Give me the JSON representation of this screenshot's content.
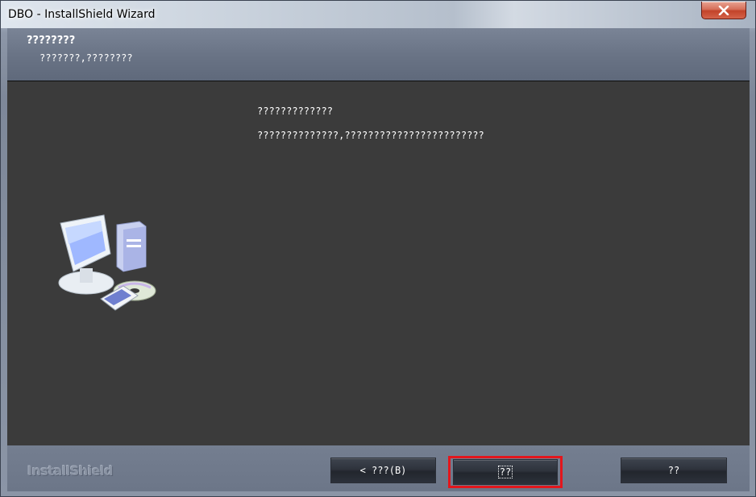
{
  "window": {
    "title": "DBO - InstallShield Wizard",
    "close_icon": "close-icon"
  },
  "header": {
    "title": "????????",
    "subtitle": "???????,????????"
  },
  "content": {
    "line1": "?????????????",
    "line2": "??????????????,????????????????????????",
    "icon": "computer-setup-icon"
  },
  "footer": {
    "brand": "InstallShield",
    "back_label": "< ???(B)",
    "next_label": "??",
    "cancel_label": "??"
  },
  "colors": {
    "content_bg": "#3b3b3b",
    "header_bg": "#6a7486",
    "highlight": "#e3161c",
    "close_red": "#c2432a"
  }
}
